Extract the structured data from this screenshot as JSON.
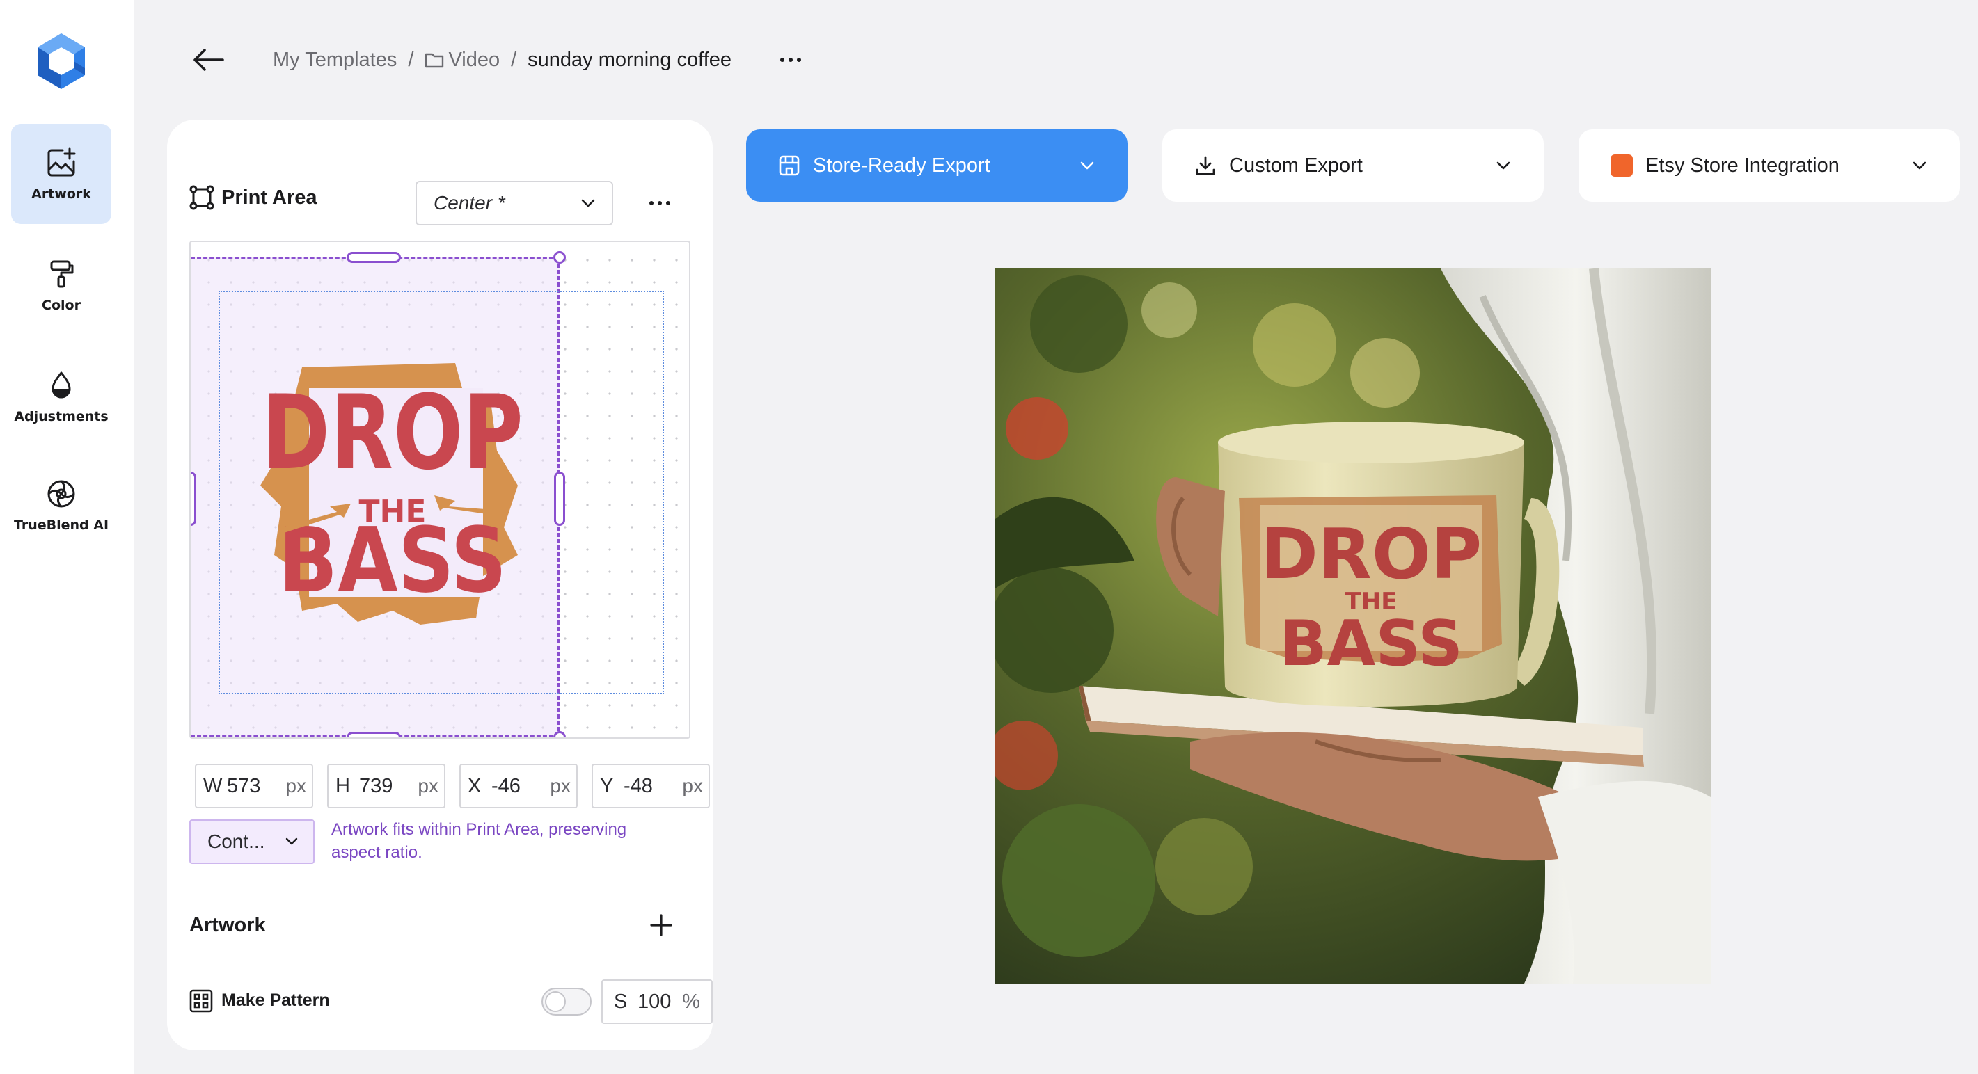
{
  "sidebar": {
    "items": [
      {
        "label": "Artwork",
        "icon": "artwork-icon",
        "active": true
      },
      {
        "label": "Color",
        "icon": "paint-roller-icon",
        "active": false
      },
      {
        "label": "Adjustments",
        "icon": "drop-icon",
        "active": false
      },
      {
        "label": "TrueBlend AI",
        "icon": "trueblend-icon",
        "active": false
      }
    ]
  },
  "breadcrumb": {
    "root": "My Templates",
    "separator": "/",
    "folder": "Video",
    "current": "sunday morning coffee"
  },
  "print_area": {
    "title": "Print Area",
    "position": "Center *"
  },
  "artwork_text": {
    "line1": "DROP",
    "line2": "THE",
    "line3": "BASS"
  },
  "dimensions": {
    "w": {
      "label": "W",
      "value": "573",
      "unit": "px"
    },
    "h": {
      "label": "H",
      "value": "739",
      "unit": "px"
    },
    "x": {
      "label": "X",
      "value": "-46",
      "unit": "px"
    },
    "y": {
      "label": "Y",
      "value": "-48",
      "unit": "px"
    }
  },
  "fit": {
    "mode": "Cont...",
    "hint": "Artwork fits within Print Area, preserving aspect ratio."
  },
  "artwork_section": {
    "title": "Artwork"
  },
  "pattern": {
    "label": "Make Pattern",
    "enabled": false,
    "scale_label": "S",
    "scale_value": "100",
    "scale_unit": "%"
  },
  "exports": {
    "store_ready": "Store-Ready Export",
    "custom": "Custom Export",
    "etsy": "Etsy Store Integration"
  },
  "colors": {
    "accent": "#3b8ef3",
    "selection": "#8a4fcf",
    "artwork_red": "#c9474f",
    "artwork_orange": "#d6924e",
    "etsy": "#f0652b"
  }
}
